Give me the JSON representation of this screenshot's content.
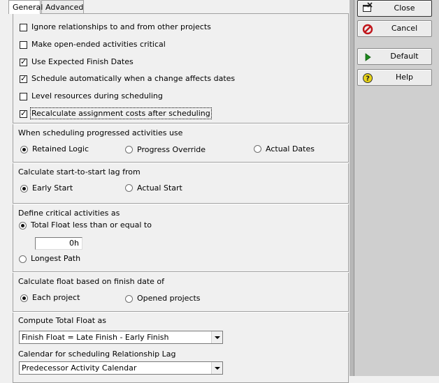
{
  "tabs": {
    "general": "General",
    "advanced": "Advanced"
  },
  "options": {
    "ignore_relationships": {
      "label": "Ignore relationships to and from other projects",
      "checked": false
    },
    "open_ended_critical": {
      "label": "Make open-ended activities critical",
      "checked": false
    },
    "use_expected_finish": {
      "label": "Use Expected Finish Dates",
      "checked": true
    },
    "schedule_automatically": {
      "label": "Schedule automatically when a change affects dates",
      "checked": true
    },
    "level_resources": {
      "label": "Level resources during scheduling",
      "checked": false
    },
    "recalculate_costs": {
      "label": "Recalculate assignment costs after scheduling",
      "checked": true
    }
  },
  "progressed": {
    "heading": "When scheduling progressed activities use",
    "retained": "Retained Logic",
    "override": "Progress Override",
    "actual": "Actual Dates",
    "selected": "retained"
  },
  "sslag": {
    "heading": "Calculate start-to-start lag from",
    "early": "Early Start",
    "actual": "Actual Start",
    "selected": "early"
  },
  "critical": {
    "heading": "Define critical activities as",
    "total_float": "Total Float less than or equal to",
    "value": "0h",
    "longest": "Longest Path",
    "selected": "total_float"
  },
  "float_basis": {
    "heading": "Calculate float based on finish date of",
    "each": "Each project",
    "opened": "Opened projects",
    "selected": "each"
  },
  "total_float": {
    "heading": "Compute Total Float as",
    "value": "Finish Float = Late Finish - Early Finish"
  },
  "lag_calendar": {
    "heading": "Calendar for scheduling Relationship Lag",
    "value": "Predecessor Activity Calendar"
  },
  "buttons": {
    "close": "Close",
    "cancel": "Cancel",
    "default": "Default",
    "help": "Help"
  },
  "colors": {
    "cancel_icon": "#c0151b",
    "default_icon": "#1d8a1d",
    "help_icon": "#e6d21a"
  }
}
